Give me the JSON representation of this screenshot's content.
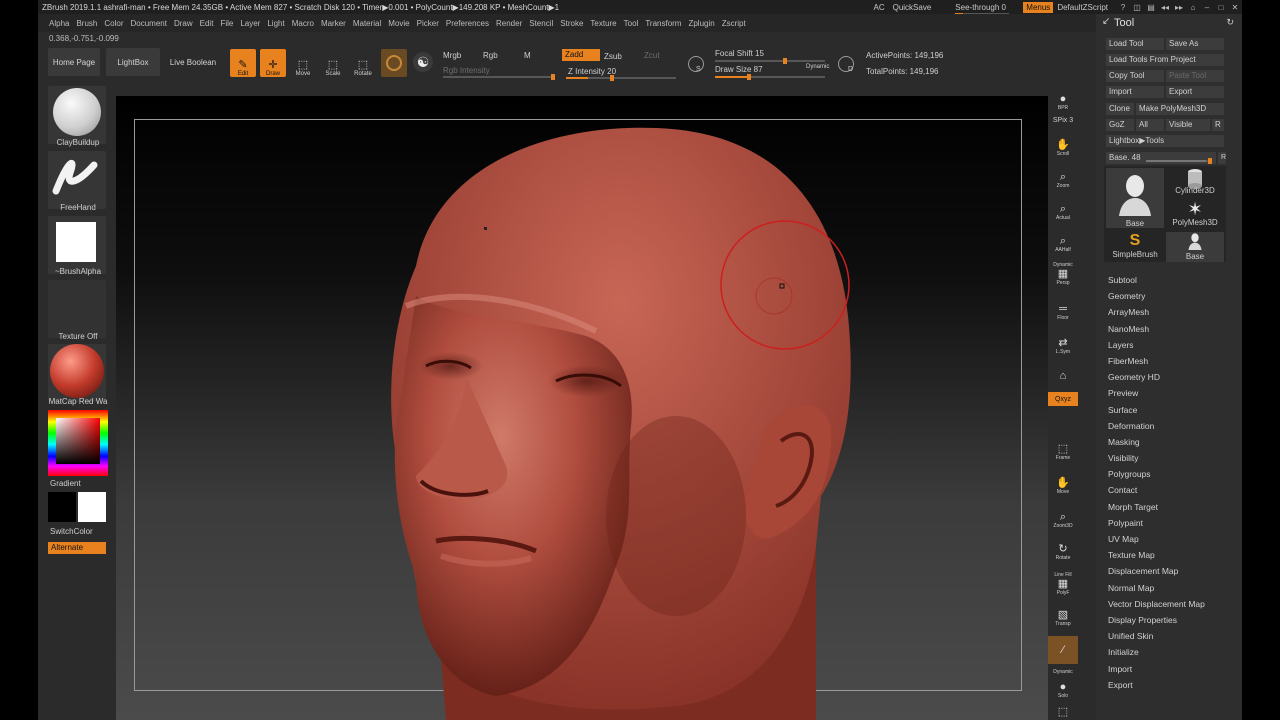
{
  "titlebar": {
    "title": "ZBrush 2019.1.1   ashrafi-man  • Free Mem 24.35GB • Active Mem 827 • Scratch Disk 120 •  Timer▶0.001 • PolyCount▶149.208 KP • MeshCount▶1",
    "ac": "AC",
    "quicksave": "QuickSave",
    "see_through": "See-through  0",
    "see_through_value": 0,
    "menus": "Menus",
    "default_zscript": "DefaultZScript"
  },
  "menubar": [
    "Alpha",
    "Brush",
    "Color",
    "Document",
    "Draw",
    "Edit",
    "File",
    "Layer",
    "Light",
    "Macro",
    "Marker",
    "Material",
    "Movie",
    "Picker",
    "Preferences",
    "Render",
    "Stencil",
    "Stroke",
    "Texture",
    "Tool",
    "Transform",
    "Zplugin",
    "Zscript"
  ],
  "coords": "0.368,-0.751,-0.099",
  "toolbar": {
    "home_page": "Home Page",
    "lightbox": "LightBox",
    "live_boolean": "Live Boolean",
    "edit": "Edit",
    "draw": "Draw",
    "move": "Move",
    "scale": "Scale",
    "rotate": "Rotate",
    "mrgb": "Mrgb",
    "rgb": "Rgb",
    "m": "M",
    "rgb_intensity": "Rgb Intensity",
    "zadd": "Zadd",
    "zsub": "Zsub",
    "zcut": "Zcut",
    "z_intensity": "Z Intensity 20",
    "focal_shift": "Focal Shift 15",
    "draw_size": "Draw Size 87",
    "dynamic": "Dynamic",
    "s_key": "S",
    "d_key": "D",
    "active_points": "ActivePoints: 149,196",
    "total_points": "TotalPoints: 149,196"
  },
  "left": {
    "brush": "ClayBuildup",
    "stroke": "FreeHand",
    "alpha": "~BrushAlpha",
    "texture": "Texture Off",
    "material": "MatCap Red Wa",
    "gradient": "Gradient",
    "switch_color": "SwitchColor",
    "alternate": "Alternate"
  },
  "right_shelf": [
    {
      "name": "bpr",
      "label": "BPR",
      "glyph": "●"
    },
    {
      "name": "spix",
      "label": "SPix 3",
      "glyph": ""
    },
    {
      "name": "scroll",
      "label": "Scroll",
      "glyph": "✋"
    },
    {
      "name": "zoom",
      "label": "Zoom",
      "glyph": "⌕"
    },
    {
      "name": "actual",
      "label": "Actual",
      "glyph": "⌕"
    },
    {
      "name": "aahalf",
      "label": "AAHalf",
      "glyph": "⌕"
    },
    {
      "name": "persp",
      "label": "Persp",
      "glyph": "▦"
    },
    {
      "name": "floor",
      "label": "Floor",
      "glyph": "═"
    },
    {
      "name": "lsym",
      "label": "L.Sym",
      "glyph": "⇄"
    },
    {
      "name": "lock",
      "label": "",
      "glyph": "⌂"
    },
    {
      "name": "xyz",
      "label": "Qxyz",
      "glyph": ""
    },
    {
      "name": "frame",
      "label": "Frame",
      "glyph": "⬚"
    },
    {
      "name": "move",
      "label": "Move",
      "glyph": "✋"
    },
    {
      "name": "zoom3d",
      "label": "Zoom3D",
      "glyph": "⌕"
    },
    {
      "name": "rotate",
      "label": "Rotate",
      "glyph": "↻"
    },
    {
      "name": "polyf",
      "label": "PolyF",
      "glyph": "▦"
    },
    {
      "name": "transp",
      "label": "Transp",
      "glyph": "▧"
    },
    {
      "name": "ghost",
      "label": "Dynamic",
      "glyph": "∕"
    },
    {
      "name": "solo",
      "label": "Solo",
      "glyph": "●"
    },
    {
      "name": "xpose",
      "label": "",
      "glyph": "⬚"
    }
  ],
  "right_shelf_extra": {
    "dynamic_label": "Dynamic",
    "line_fill": "Line Fill"
  },
  "tool_panel": {
    "title": "Tool",
    "load_tool": "Load Tool",
    "save_as": "Save As",
    "load_from_project": "Load Tools From Project",
    "copy_tool": "Copy Tool",
    "paste_tool": "Paste Tool",
    "import": "Import",
    "export": "Export",
    "clone": "Clone",
    "make_polymesh": "Make PolyMesh3D",
    "goz": "GoZ",
    "all": "All",
    "visible": "Visible",
    "r": "R",
    "lightbox_tools": "Lightbox▶Tools",
    "base": "Base. 48",
    "base_value": 48,
    "thumbs": [
      "Base",
      "Cylinder3D",
      "PolyMesh3D",
      "SimpleBrush",
      "Base"
    ],
    "sections": [
      "Subtool",
      "Geometry",
      "ArrayMesh",
      "NanoMesh",
      "Layers",
      "FiberMesh",
      "Geometry HD",
      "Preview",
      "Surface",
      "Deformation",
      "Masking",
      "Visibility",
      "Polygroups",
      "Contact",
      "Morph Target",
      "Polypaint",
      "UV Map",
      "Texture Map",
      "Displacement Map",
      "Normal Map",
      "Vector Displacement Map",
      "Display Properties",
      "Unified Skin",
      "Initialize",
      "Import",
      "Export"
    ]
  },
  "colors": {
    "accent": "#e8821f",
    "skin": "#a8473a"
  }
}
